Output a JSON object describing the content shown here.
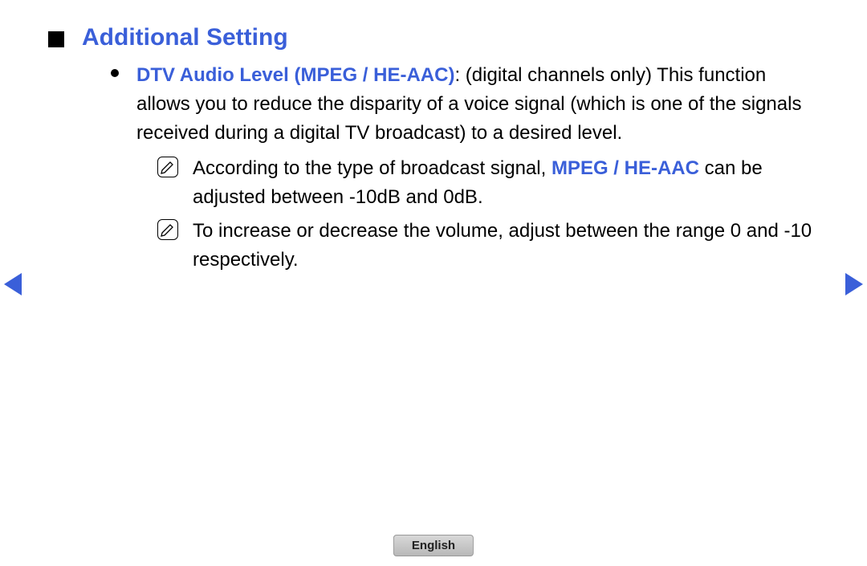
{
  "heading": "Additional Setting",
  "item": {
    "label": "DTV Audio Level (MPEG / HE-AAC)",
    "desc": ": (digital channels only) This function allows you to reduce the disparity of a voice signal (which is one of the signals received during a digital TV broadcast) to a desired level."
  },
  "notes": [
    {
      "pre": "According to the type of broadcast signal, ",
      "highlight": "MPEG / HE-AAC",
      "post": " can be adjusted between -10dB and 0dB."
    },
    {
      "pre": "To increase or decrease the volume, adjust between the range 0 and -10 respectively.",
      "highlight": "",
      "post": ""
    }
  ],
  "language": "English"
}
